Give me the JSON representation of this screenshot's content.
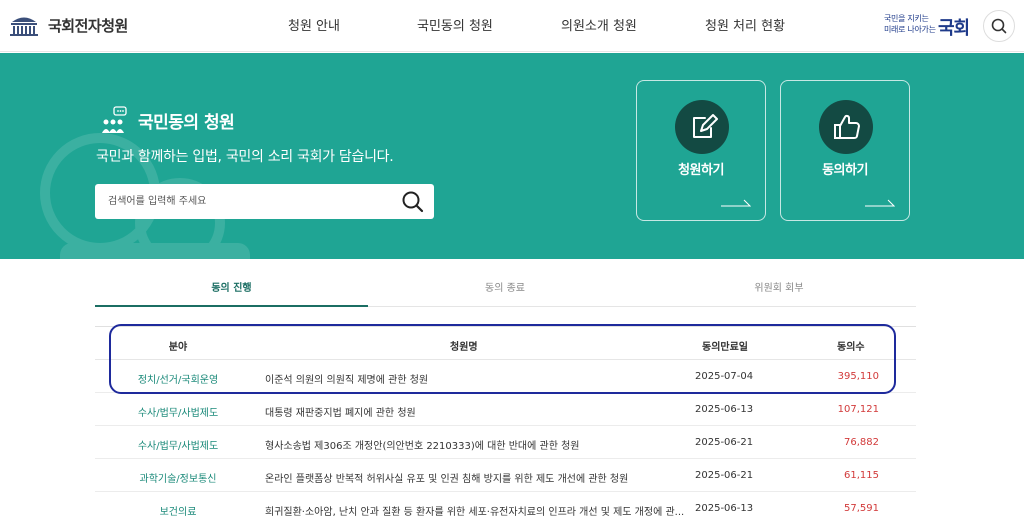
{
  "header": {
    "logo_text": "국회전자청원",
    "nav": [
      "청원 안내",
      "국민동의 청원",
      "의원소개 청원",
      "청원 처리 현황"
    ],
    "slogan_line1": "국민을 지키는",
    "slogan_line2": "미래로 나아가는",
    "slogan_big": "국회"
  },
  "banner": {
    "title": "국민동의 청원",
    "description": "국민과 함께하는 입법, 국민의 소리 국회가 담습니다.",
    "search_placeholder": "검색어를 입력해 주세요",
    "actions": [
      {
        "label": "청원하기",
        "icon": "pencil-icon"
      },
      {
        "label": "동의하기",
        "icon": "thumbs-up-icon"
      }
    ],
    "colors": {
      "bg": "#1fa594",
      "circle": "#134a43"
    }
  },
  "tabs": [
    {
      "label": "동의 진행",
      "active": true
    },
    {
      "label": "동의 종료",
      "active": false
    },
    {
      "label": "위원회 회부",
      "active": false
    }
  ],
  "table": {
    "headers": [
      "분야",
      "청원명",
      "동의만료일",
      "동의수"
    ],
    "rows": [
      {
        "category": "정치/선거/국회운영",
        "title": "이준석 의원의 의원직 제명에 관한 청원",
        "date": "2025-07-04",
        "count": "395,110"
      },
      {
        "category": "수사/법무/사법제도",
        "title": "대통령 재판중지법 폐지에 관한 청원",
        "date": "2025-06-13",
        "count": "107,121"
      },
      {
        "category": "수사/법무/사법제도",
        "title": "형사소송법 제306조 개정안(의안번호 2210333)에 대한 반대에 관한 청원",
        "date": "2025-06-21",
        "count": "76,882"
      },
      {
        "category": "과학기술/정보통신",
        "title": "온라인 플랫폼상 반복적 허위사실 유포 및 인권 침해 방지를 위한 제도 개선에 관한 청원",
        "date": "2025-06-21",
        "count": "61,115"
      },
      {
        "category": "보건의료",
        "title": "희귀질환·소아암, 난치 안과 질환 등 환자를 위한 세포·유전자치료의 인프라 개선 및 제도 개정에 관...",
        "date": "2025-06-13",
        "count": "57,591"
      }
    ]
  }
}
